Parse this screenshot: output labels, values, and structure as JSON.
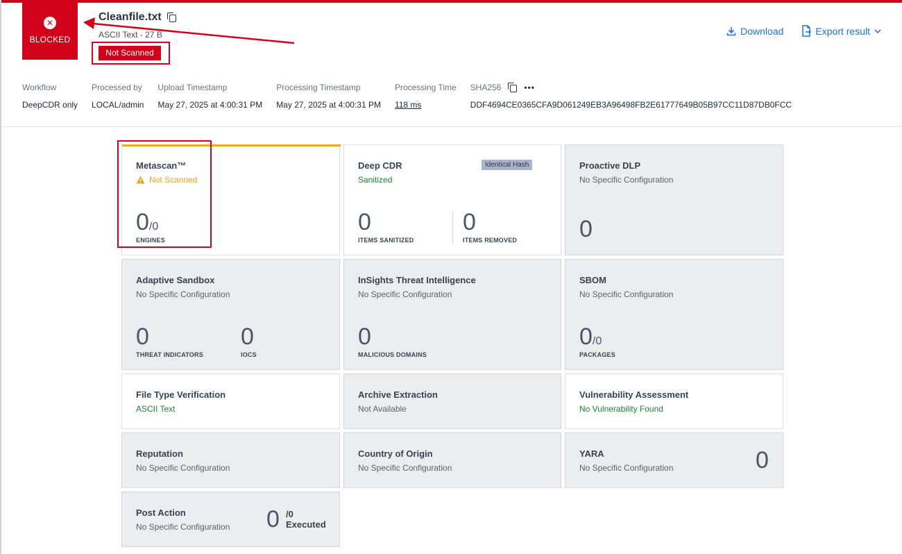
{
  "verdict": {
    "label": "BLOCKED",
    "icon": "close-icon",
    "color": "#d0021b"
  },
  "file": {
    "name": "Cleanfile.txt",
    "type_size": "ASCII Text - 27 B",
    "scan_badge": "Not Scanned"
  },
  "actions": {
    "download": "Download",
    "export": "Export result"
  },
  "meta": {
    "workflow": {
      "label": "Workflow",
      "value": "DeepCDR only"
    },
    "processed_by": {
      "label": "Processed by",
      "value": "LOCAL/admin"
    },
    "upload_ts": {
      "label": "Upload Timestamp",
      "value": "May 27, 2025 at 4:00:31 PM"
    },
    "processing_ts": {
      "label": "Processing Timestamp",
      "value": "May 27, 2025 at 4:00:31 PM"
    },
    "processing_time": {
      "label": "Processing Time",
      "value": "118 ms"
    },
    "sha256": {
      "label": "SHA256",
      "value": "DDF4694CE0365CFA9D061249EB3A96498FB2E61777649B05B97CC11D87DB0FCC"
    }
  },
  "cards": {
    "metascan": {
      "title": "Metascan™",
      "status": "Not Scanned",
      "num": "0",
      "denom": "/0",
      "num_label": "ENGINES"
    },
    "deepcdr": {
      "title": "Deep CDR",
      "status": "Sanitized",
      "badge": "Identical Hash",
      "num1": "0",
      "label1": "ITEMS SANITIZED",
      "num2": "0",
      "label2": "ITEMS REMOVED"
    },
    "dlp": {
      "title": "Proactive DLP",
      "status": "No Specific Configuration",
      "num": "0"
    },
    "sandbox": {
      "title": "Adaptive Sandbox",
      "status": "No Specific Configuration",
      "num1": "0",
      "label1": "THREAT INDICATORS",
      "num2": "0",
      "label2": "IOCS"
    },
    "insights": {
      "title": "InSights Threat Intelligence",
      "status": "No Specific Configuration",
      "num": "0",
      "num_label": "MALICIOUS DOMAINS"
    },
    "sbom": {
      "title": "SBOM",
      "status": "No Specific Configuration",
      "num": "0",
      "denom": "/0",
      "num_label": "PACKAGES"
    },
    "filetype": {
      "title": "File Type Verification",
      "status": "ASCII Text"
    },
    "archive": {
      "title": "Archive Extraction",
      "status": "Not Available"
    },
    "vuln": {
      "title": "Vulnerability Assessment",
      "status": "No Vulnerability Found"
    },
    "reputation": {
      "title": "Reputation",
      "status": "No Specific Configuration"
    },
    "origin": {
      "title": "Country of Origin",
      "status": "No Specific Configuration"
    },
    "yara": {
      "title": "YARA",
      "status": "No Specific Configuration",
      "num": "0"
    },
    "postaction": {
      "title": "Post Action",
      "status": "No Specific Configuration",
      "num": "0",
      "denom": "/0",
      "num_label": "Executed"
    }
  }
}
